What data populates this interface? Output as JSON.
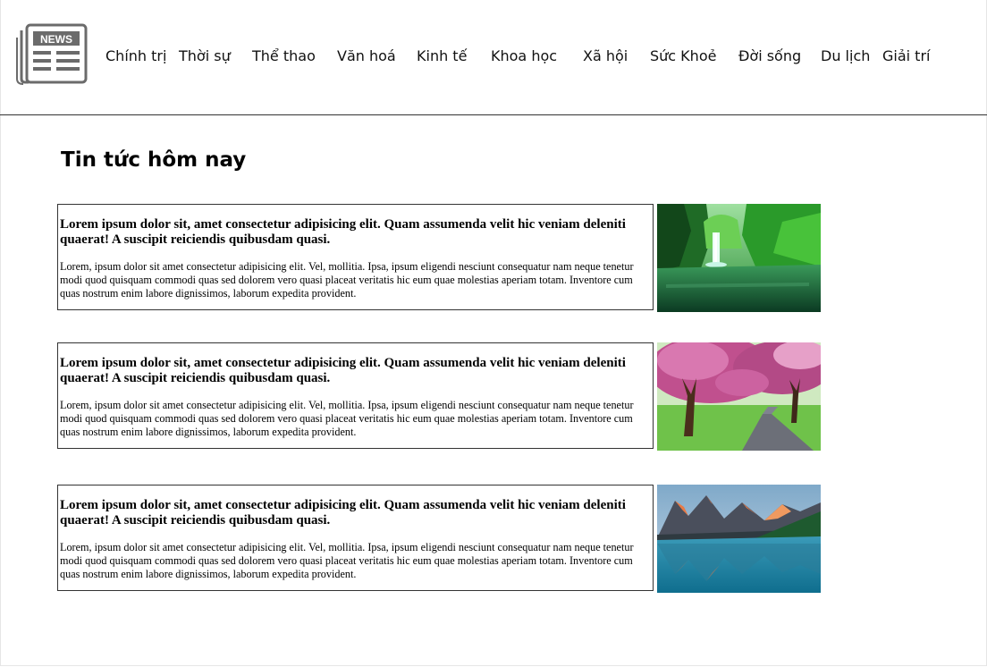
{
  "logo": {
    "icon": "newspaper-icon",
    "text": "NEWS"
  },
  "nav": {
    "items": [
      {
        "label": "Chính trị"
      },
      {
        "label": "Thời sự"
      },
      {
        "label": "Thể thao"
      },
      {
        "label": "Văn hoá"
      },
      {
        "label": "Kinh tế"
      },
      {
        "label": "Khoa học"
      },
      {
        "label": "Xã hội"
      },
      {
        "label": "Sức Khoẻ"
      },
      {
        "label": "Đời sống"
      },
      {
        "label": "Du lịch"
      },
      {
        "label": "Giải trí"
      }
    ]
  },
  "main": {
    "title": "Tin tức hôm nay",
    "articles": [
      {
        "headline": "Lorem ipsum dolor sit, amet consectetur adipisicing elit. Quam assumenda velit hic veniam deleniti quaerat! A suscipit reiciendis quibusdam quasi.",
        "body": "Lorem, ipsum dolor sit amet consectetur adipisicing elit. Vel, mollitia. Ipsa, ipsum eligendi nesciunt consequatur nam neque tenetur modi quod quisquam commodi quas sed dolorem vero quasi placeat veritatis hic eum quae molestias aperiam totam. Inventore cum quas nostrum enim labore dignissimos, laborum expedita provident.",
        "image": "waterfall-photo"
      },
      {
        "headline": "Lorem ipsum dolor sit, amet consectetur adipisicing elit. Quam assumenda velit hic veniam deleniti quaerat! A suscipit reiciendis quibusdam quasi.",
        "body": "Lorem, ipsum dolor sit amet consectetur adipisicing elit. Vel, mollitia. Ipsa, ipsum eligendi nesciunt consequatur nam neque tenetur modi quod quisquam commodi quas sed dolorem vero quasi placeat veritatis hic eum quae molestias aperiam totam. Inventore cum quas nostrum enim labore dignissimos, laborum expedita provident.",
        "image": "cherry-blossom-photo"
      },
      {
        "headline": "Lorem ipsum dolor sit, amet consectetur adipisicing elit. Quam assumenda velit hic veniam deleniti quaerat! A suscipit reiciendis quibusdam quasi.",
        "body": "Lorem, ipsum dolor sit amet consectetur adipisicing elit. Vel, mollitia. Ipsa, ipsum eligendi nesciunt consequatur nam neque tenetur modi quod quisquam commodi quas sed dolorem vero quasi placeat veritatis hic eum quae molestias aperiam totam. Inventore cum quas nostrum enim labore dignissimos, laborum expedita provident.",
        "image": "mountain-lake-photo"
      }
    ]
  }
}
